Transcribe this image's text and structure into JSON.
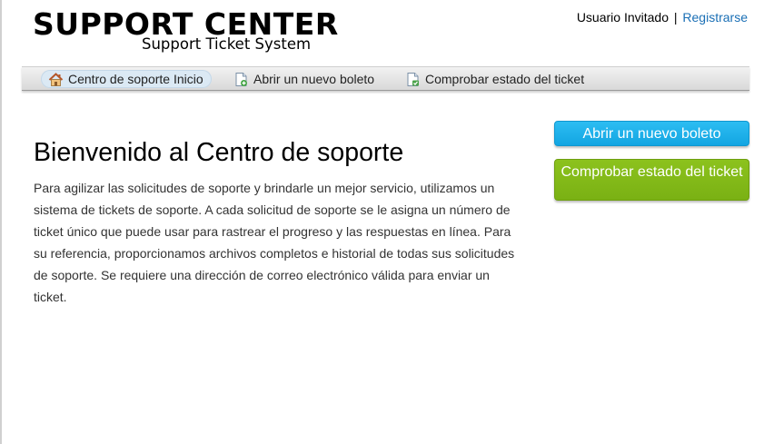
{
  "header": {
    "logo_title": "SUPPORT CENTER",
    "logo_subtitle": "Support Ticket System",
    "guest_label": "Usuario Invitado",
    "separator": "|",
    "register_link": "Registrarse"
  },
  "nav": {
    "items": [
      {
        "label": "Centro de soporte Inicio",
        "icon": "home-icon",
        "active": true
      },
      {
        "label": "Abrir un nuevo boleto",
        "icon": "new-ticket-icon",
        "active": false
      },
      {
        "label": "Comprobar estado del ticket",
        "icon": "ticket-status-icon",
        "active": false
      }
    ]
  },
  "main": {
    "title": "Bienvenido al Centro de soporte",
    "paragraph": "Para agilizar las solicitudes de soporte y brindarle un mejor servicio, utilizamos un sistema de tickets de soporte. A cada solicitud de soporte se le asigna un número de ticket único que puede usar para rastrear el progreso y las respuestas en línea. Para su referencia, proporcionamos archivos completos e historial de todas sus solicitudes de soporte. Se requiere una dirección de correo electrónico válida para enviar un ticket."
  },
  "sidebar": {
    "open_ticket_button": "Abrir un nuevo boleto",
    "check_status_button": "Comprobar estado del ticket"
  },
  "colors": {
    "blue_button": "#1ab0ea",
    "green_button": "#84ba18",
    "link": "#1a6fb5",
    "active_nav": "#dbe9f4"
  }
}
